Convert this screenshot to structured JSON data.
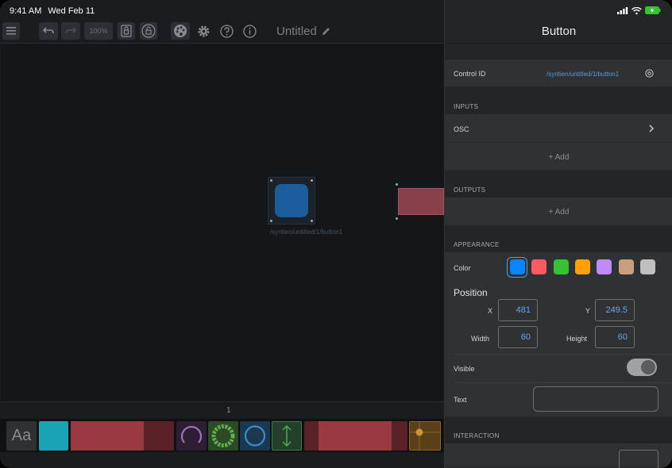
{
  "status": {
    "time": "9:41 AM",
    "date": "Wed Feb 11"
  },
  "toolbar": {
    "zoom": "100%",
    "title": "Untitled"
  },
  "canvas": {
    "widget_path": "/syntien/untitled/1/button1"
  },
  "pagebar": {
    "page": "1"
  },
  "palette": {
    "text_item": "Aa"
  },
  "panel": {
    "title": "Button",
    "control_id_label": "Control ID",
    "control_id_value": "/syntien/untitled/1/button1",
    "inputs_header": "INPUTS",
    "osc_label": "OSC",
    "add_label_1": "+ Add",
    "outputs_header": "OUTPUTS",
    "add_label_2": "+ Add",
    "appearance_header": "APPEARANCE",
    "color_label": "Color",
    "colors": [
      "#0a84ff",
      "#ff5a5f",
      "#35c234",
      "#ff9f0a",
      "#bf8aff",
      "#c8a07e",
      "#bfbfbf"
    ],
    "position_label": "Position",
    "x_label": "X",
    "x_value": "481",
    "y_label": "Y",
    "y_value": "249.5",
    "width_label": "Width",
    "width_value": "60",
    "height_label": "Height",
    "height_value": "60",
    "visible_label": "Visible",
    "text_label": "Text",
    "text_value": "",
    "interaction_header": "INTERACTION"
  }
}
